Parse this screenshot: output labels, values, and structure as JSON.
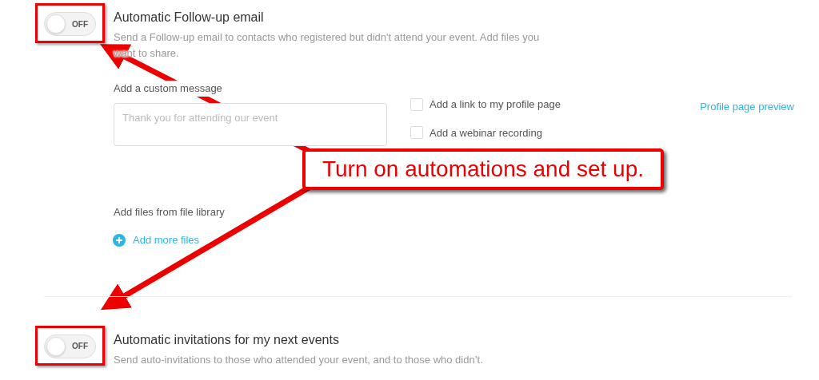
{
  "sections": [
    {
      "toggle": {
        "on": false,
        "label": "OFF"
      },
      "title": "Automatic Follow-up email",
      "description": "Send a Follow-up email to contacts who registered but didn't attend your event. Add files you want to share.",
      "message": {
        "label": "Add a custom message",
        "placeholder": "Thank you for attending our event"
      },
      "options": [
        {
          "label": "Add a link to my profile page",
          "checked": false
        },
        {
          "label": "Add a webinar recording",
          "checked": false
        }
      ],
      "preview_link": "Profile page preview",
      "files": {
        "label": "Add files from file library",
        "add_button": "Add more files"
      }
    },
    {
      "toggle": {
        "on": false,
        "label": "OFF"
      },
      "title": "Automatic invitations for my next events",
      "description": "Send auto-invitations to those who attended your event, and to those who didn’t."
    }
  ],
  "annotation": {
    "callout": "Turn on automations and set up."
  }
}
